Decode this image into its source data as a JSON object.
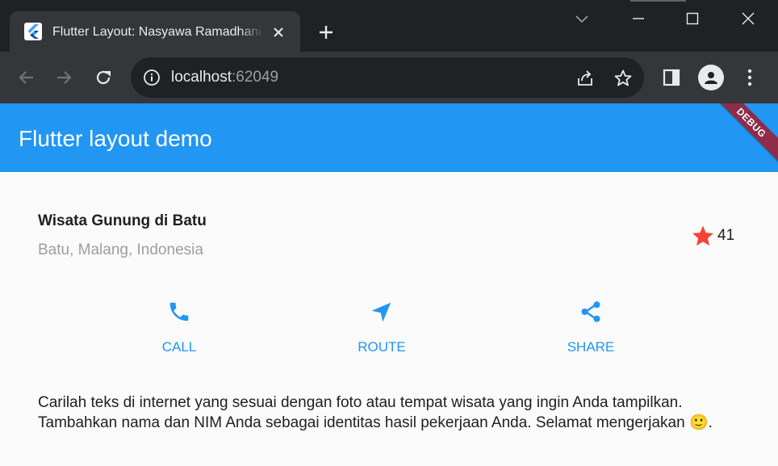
{
  "browser": {
    "tab_title": "Flutter Layout: Nasyawa Ramadhani",
    "url_host": "localhost",
    "url_port": ":62049",
    "colors": {
      "tabstrip": "#202124",
      "toolbar": "#35363a",
      "omnibox": "#202124"
    }
  },
  "app": {
    "title": "Flutter layout demo",
    "debug_banner": "DEBUG",
    "colors": {
      "primary": "#2196f3",
      "star": "#f44336",
      "banner": "#8d2d4a"
    }
  },
  "place": {
    "title": "Wisata Gunung di Batu",
    "location": "Batu, Malang, Indonesia",
    "favorite_count": "41"
  },
  "actions": [
    {
      "label": "CALL",
      "icon": "phone-icon"
    },
    {
      "label": "ROUTE",
      "icon": "navigation-icon"
    },
    {
      "label": "SHARE",
      "icon": "share-icon"
    }
  ],
  "description": "Carilah teks di internet yang sesuai dengan foto atau tempat wisata yang ingin Anda tampilkan. Tambahkan nama dan NIM Anda sebagai identitas hasil pekerjaan Anda. Selamat mengerjakan 🙂."
}
